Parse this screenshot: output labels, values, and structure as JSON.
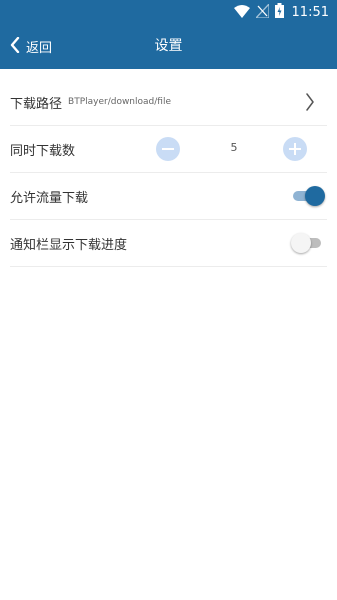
{
  "status_bar": {
    "time": "11:51",
    "icons": [
      "wifi-icon",
      "no-signal-icon",
      "battery-charging-icon"
    ]
  },
  "header": {
    "back_label": "返回",
    "title": "设置",
    "background": "#1f6aa0"
  },
  "settings": {
    "download_path": {
      "label": "下载路径",
      "value": "BTPlayer/download/file"
    },
    "concurrent_downloads": {
      "label": "同时下载数",
      "value": "5"
    },
    "allow_mobile_data": {
      "label": "允许流量下载",
      "enabled": true
    },
    "notification_progress": {
      "label": "通知栏显示下载进度",
      "enabled": false
    }
  },
  "colors": {
    "accent": "#1f6aa0",
    "stepper": "#c9dcf5",
    "divider": "#ececec"
  }
}
